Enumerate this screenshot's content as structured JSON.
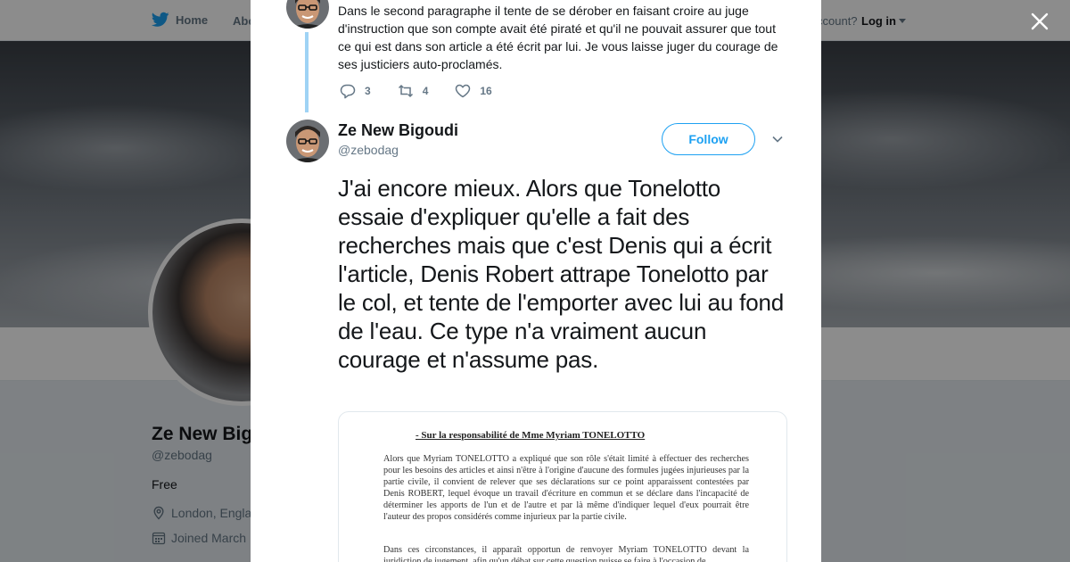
{
  "nav": {
    "home_label": "Home",
    "about_label": "Abo",
    "account_prompt": "ccount?",
    "login_label": "Log in"
  },
  "profile": {
    "name": "Ze New Big",
    "handle": "@zebodag",
    "bio": "Free",
    "location": "London, Engla",
    "joined": "Joined March"
  },
  "previous_tweet": {
    "text": "Dans le second paragraphe il tente de se dérober en faisant croire au juge d'instruction que son compte avait été piraté et qu'il ne pouvait assurer que tout ce qui est dans son article a été écrit par lui. Je vous laisse juger du courage de ses justiciers auto-proclamés.",
    "replies": "3",
    "retweets": "4",
    "likes": "16"
  },
  "tweet": {
    "author_name": "Ze New Bigoudi",
    "author_handle": "@zebodag",
    "follow_label": "Follow",
    "text": "J'ai encore mieux. Alors que Tonelotto essaie d'expliquer qu'elle a fait des recherches mais que c'est Denis qui a écrit l'article, Denis Robert attrape Tonelotto par le col, et tente de l'emporter avec lui au fond de l'eau. Ce type n'a vraiment aucun courage et n'assume pas."
  },
  "document": {
    "heading": "- Sur la responsabilité de Mme Myriam TONELOTTO",
    "paragraph1": "Alors que Myriam TONELOTTO a expliqué que son rôle s'était limité à effectuer des recherches pour les besoins des articles et ainsi n'être à l'origine d'aucune des formules jugées injurieuses par la partie civile, il convient de relever que ses déclarations sur ce point apparaissent contestées par Denis ROBERT, lequel évoque un travail d'écriture en commun et se déclare dans l'incapacité de déterminer les apports de l'un et de l'autre et par là même d'indiquer lequel d'eux pourrait être l'auteur des propos considérés comme injurieux par la partie civile.",
    "paragraph2": "Dans ces circonstances, il apparaît opportun de renvoyer Myriam TONELOTTO devant la juridiction de jugement, afin qu'un débat sur cette question puisse se faire à l'occasion de"
  },
  "colors": {
    "brand_blue": "#1da1f2",
    "thread_line": "#9fd3f5",
    "text_primary": "#14171a",
    "text_secondary": "#657786"
  },
  "icons": [
    "twitter-bird-icon",
    "close-icon",
    "reply-icon",
    "retweet-icon",
    "heart-icon",
    "chevron-down-icon",
    "location-pin-icon",
    "calendar-icon"
  ]
}
